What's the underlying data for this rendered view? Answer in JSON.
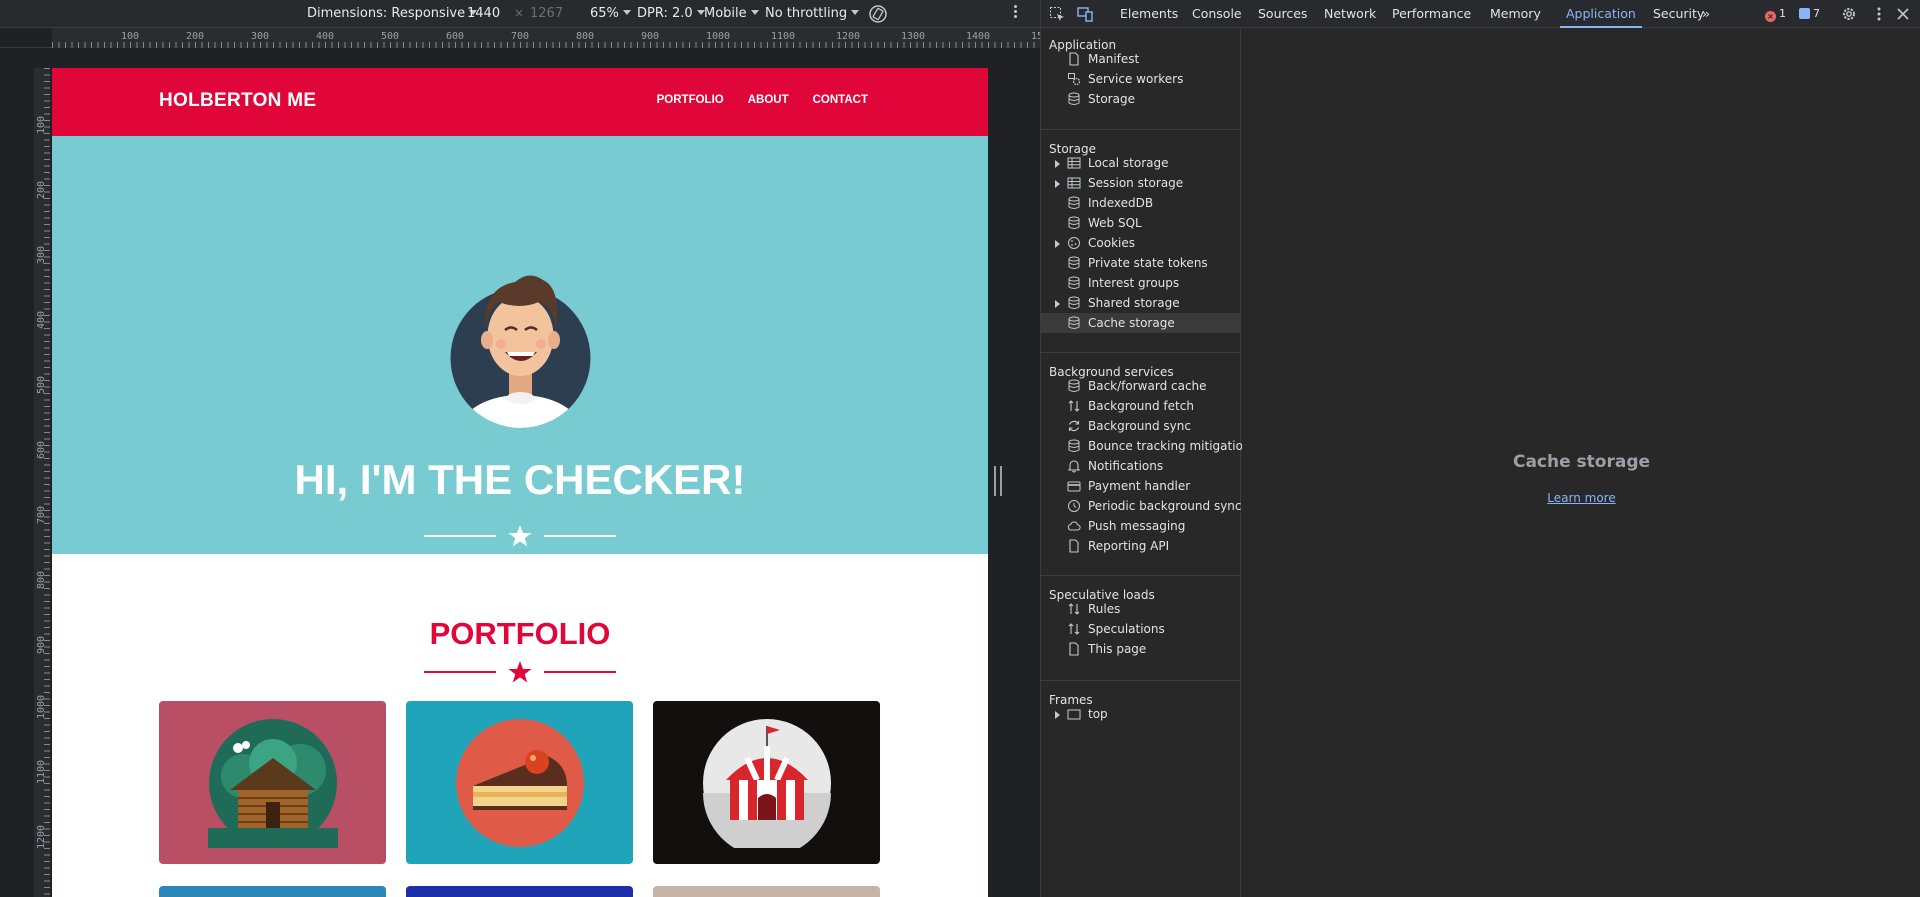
{
  "device_toolbar": {
    "dimensions_label": "Dimensions: Responsive",
    "width_value": "1440",
    "times": "×",
    "height_value": "1267",
    "zoom": "65%",
    "dpr": "DPR: 2.0",
    "device_type": "Mobile",
    "throttling": "No throttling"
  },
  "rulers": {
    "top_labels": [
      "100",
      "200",
      "300",
      "400",
      "500",
      "600",
      "700",
      "800",
      "900",
      "1000",
      "1100",
      "1200",
      "1300",
      "1400",
      "15"
    ],
    "left_labels": [
      "100",
      "200",
      "300",
      "400",
      "500",
      "600",
      "700",
      "800",
      "900",
      "1000",
      "1100",
      "1200"
    ]
  },
  "site": {
    "logo": "HOLBERTON ME",
    "nav": [
      "PORTFOLIO",
      "ABOUT",
      "CONTACT"
    ],
    "hero_title": "HI, I'M THE CHECKER!",
    "portfolio_title": "PORTFOLIO",
    "colors": {
      "primary": "#e0063a",
      "hero_bg": "#78ccd1"
    },
    "cards": [
      {
        "bg": "#b94f64",
        "icon": "log-cabin-icon"
      },
      {
        "bg": "#1fa4b9",
        "icon": "cake-slice-icon"
      },
      {
        "bg": "#140f0f",
        "icon": "circus-tent-icon"
      }
    ],
    "next_row_colors": [
      "#2a87b8",
      "#1b2fa6",
      "#c9b2a6"
    ]
  },
  "devtools": {
    "tabs": [
      "Elements",
      "Console",
      "Sources",
      "Network",
      "Performance",
      "Memory",
      "Application",
      "Security"
    ],
    "active_tab": "Application",
    "error_count": "1",
    "message_count": "7",
    "sidebar": {
      "application": {
        "title": "Application",
        "items": [
          "Manifest",
          "Service workers",
          "Storage"
        ]
      },
      "storage": {
        "title": "Storage",
        "items": [
          "Local storage",
          "Session storage",
          "IndexedDB",
          "Web SQL",
          "Cookies",
          "Private state tokens",
          "Interest groups",
          "Shared storage",
          "Cache storage"
        ]
      },
      "background": {
        "title": "Background services",
        "items": [
          "Back/forward cache",
          "Background fetch",
          "Background sync",
          "Bounce tracking mitigations",
          "Notifications",
          "Payment handler",
          "Periodic background sync",
          "Push messaging",
          "Reporting API"
        ]
      },
      "speculative": {
        "title": "Speculative loads",
        "items": [
          "Rules",
          "Speculations",
          "This page"
        ]
      },
      "frames": {
        "title": "Frames",
        "items": [
          "top"
        ]
      }
    },
    "selected_item": "Cache storage",
    "main": {
      "title": "Cache storage",
      "link": "Learn more"
    }
  }
}
